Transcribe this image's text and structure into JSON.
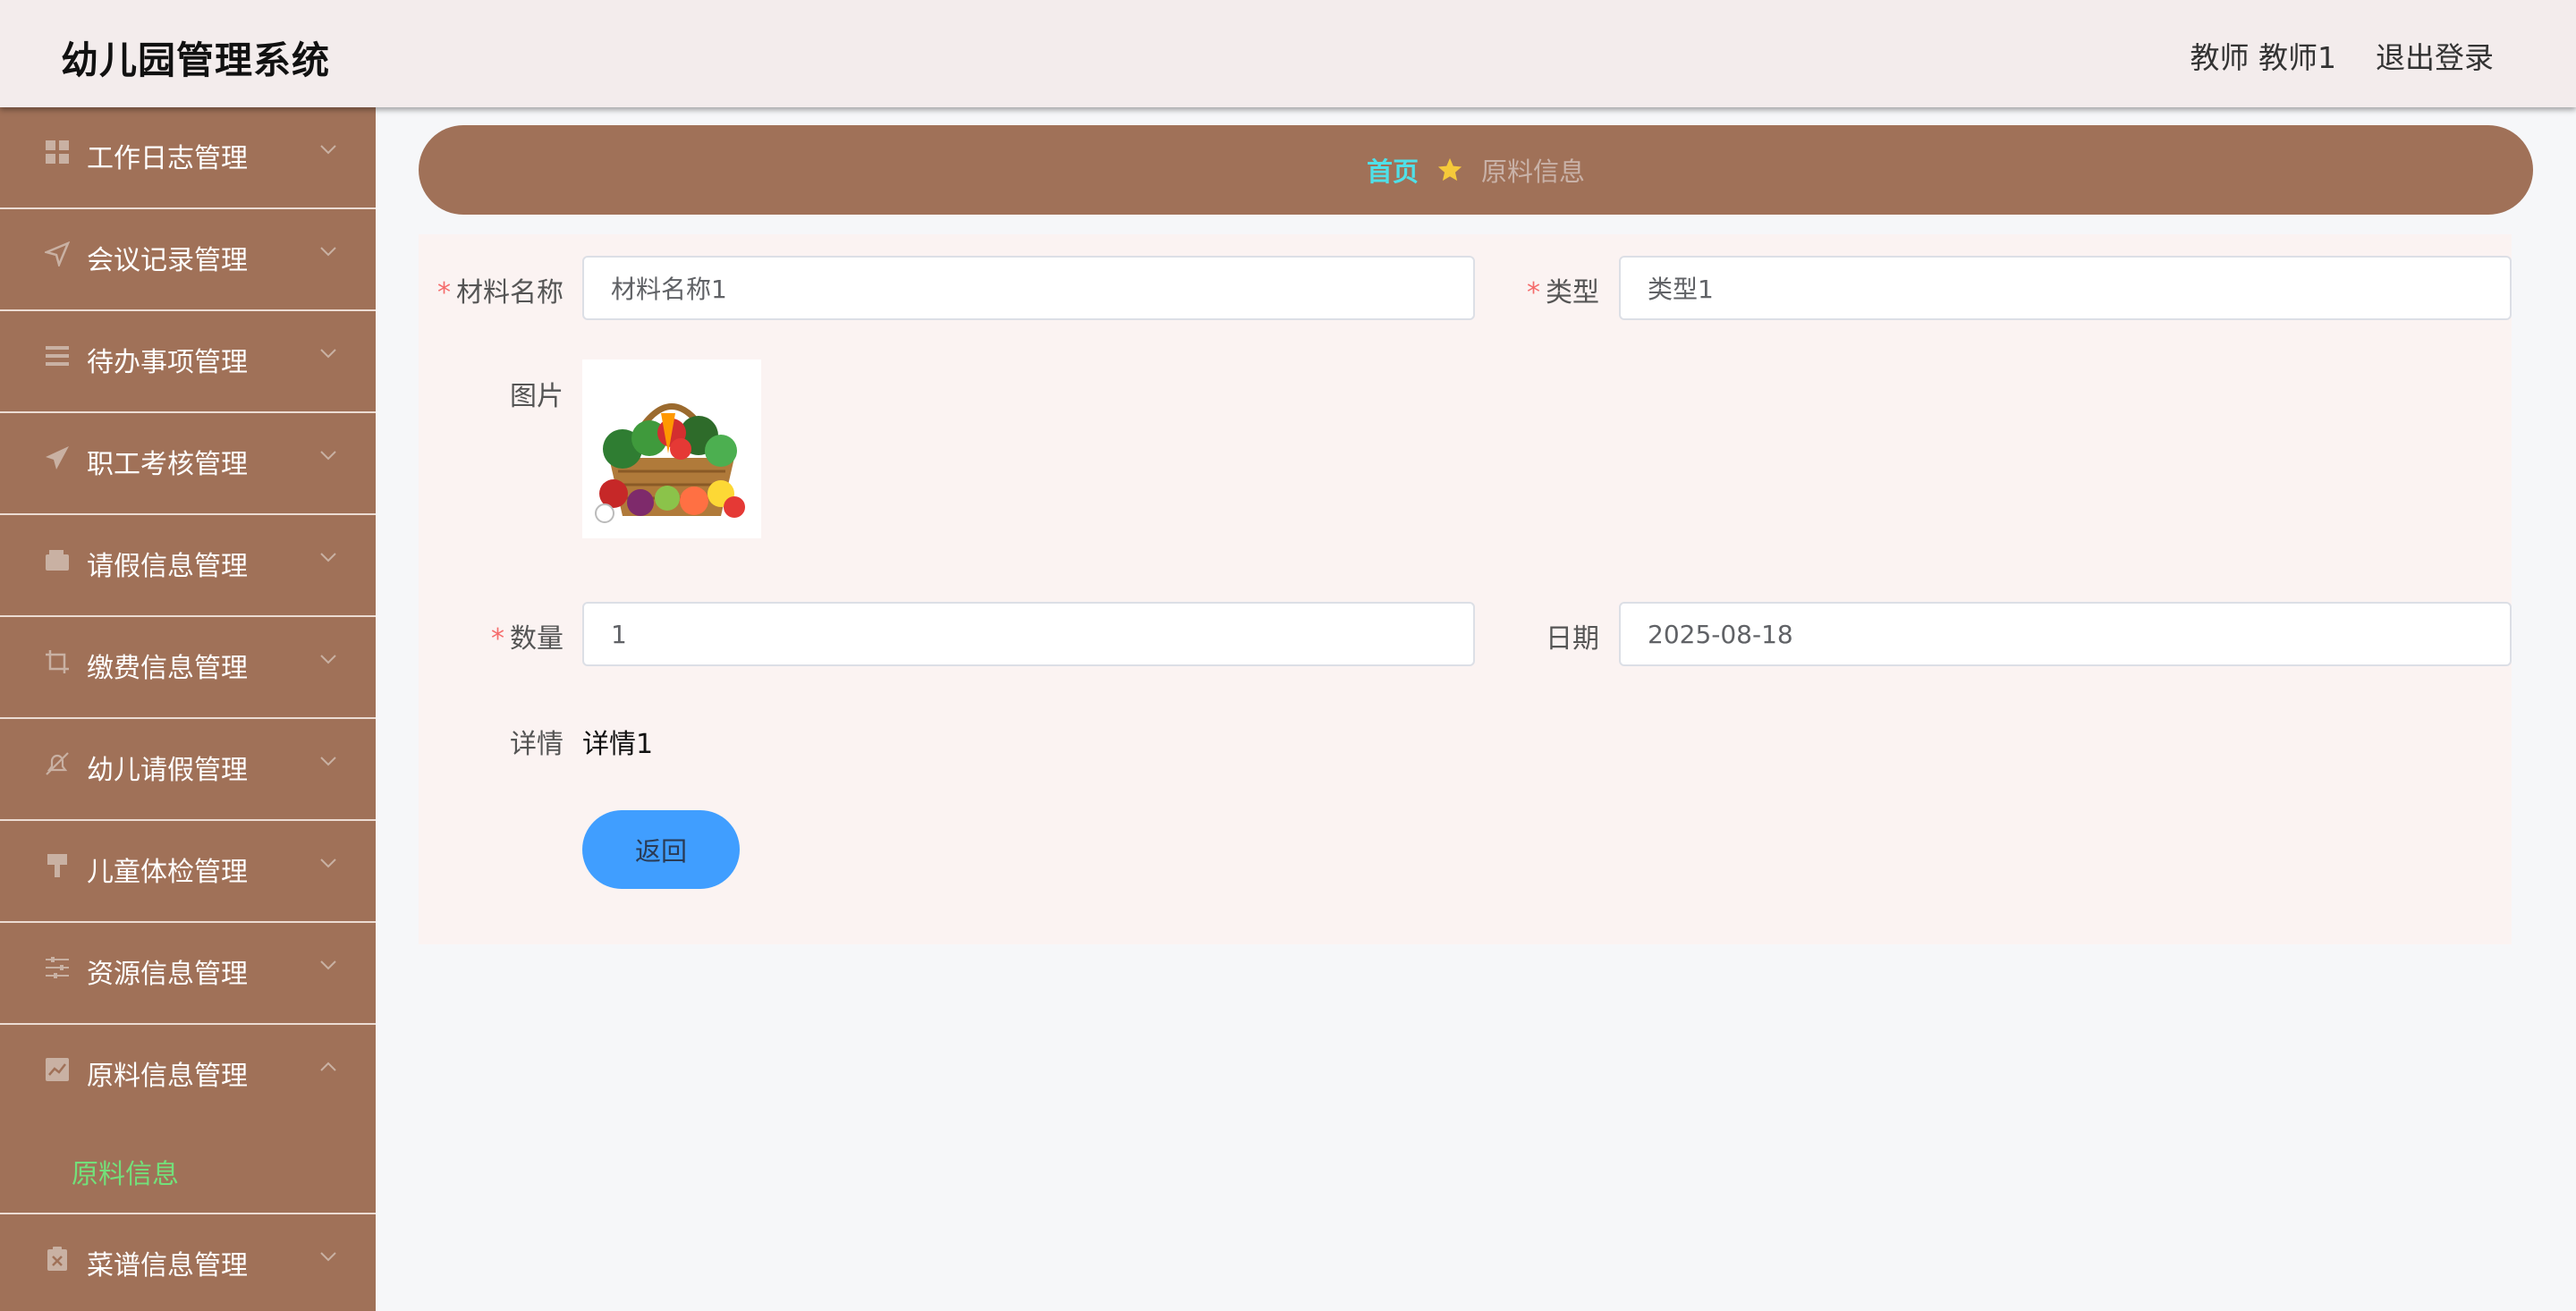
{
  "header": {
    "title": "幼儿园管理系统",
    "user": "教师 教师1",
    "logout": "退出登录"
  },
  "sidebar": {
    "items": [
      {
        "label": "工作日志管理",
        "icon": "grid-icon"
      },
      {
        "label": "会议记录管理",
        "icon": "send-icon"
      },
      {
        "label": "待办事项管理",
        "icon": "list-icon"
      },
      {
        "label": "职工考核管理",
        "icon": "paper-plane-icon"
      },
      {
        "label": "请假信息管理",
        "icon": "wallet-icon"
      },
      {
        "label": "缴费信息管理",
        "icon": "crop-icon"
      },
      {
        "label": "幼儿请假管理",
        "icon": "bell-off-icon"
      },
      {
        "label": "儿童体检管理",
        "icon": "brush-icon"
      },
      {
        "label": "资源信息管理",
        "icon": "sliders-icon"
      },
      {
        "label": "原料信息管理",
        "icon": "chart-icon"
      },
      {
        "label": "菜谱信息管理",
        "icon": "checklist-icon"
      }
    ],
    "submenu": {
      "label": "原料信息"
    }
  },
  "breadcrumb": {
    "home": "首页",
    "current": "原料信息"
  },
  "form": {
    "name_label": "材料名称",
    "name_value": "材料名称1",
    "type_label": "类型",
    "type_value": "类型1",
    "image_label": "图片",
    "qty_label": "数量",
    "qty_value": "1",
    "date_label": "日期",
    "date_value": "2025-08-18",
    "detail_label": "详情",
    "detail_value": "详情1",
    "back_label": "返回"
  },
  "colors": {
    "sidebar_bg": "#a07158",
    "header_bg": "#f3ecec",
    "active_submenu": "#73e07a",
    "breadcrumb_home": "#4fe0e8",
    "button": "#409eff"
  }
}
